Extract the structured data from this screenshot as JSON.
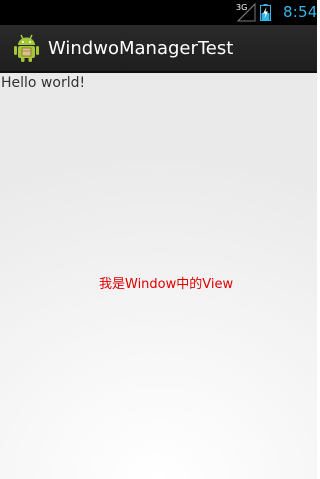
{
  "status_bar": {
    "network_label": "3G",
    "time": "8:54",
    "icons": [
      "signal-icon",
      "battery-icon"
    ],
    "time_color": "#33b5e5"
  },
  "action_bar": {
    "app_icon": "android-icon",
    "title": "WindwoManagerTest"
  },
  "content": {
    "text": "Hello world!",
    "window_view_text": "我是Window中的View",
    "window_view_color": "#e00000"
  }
}
